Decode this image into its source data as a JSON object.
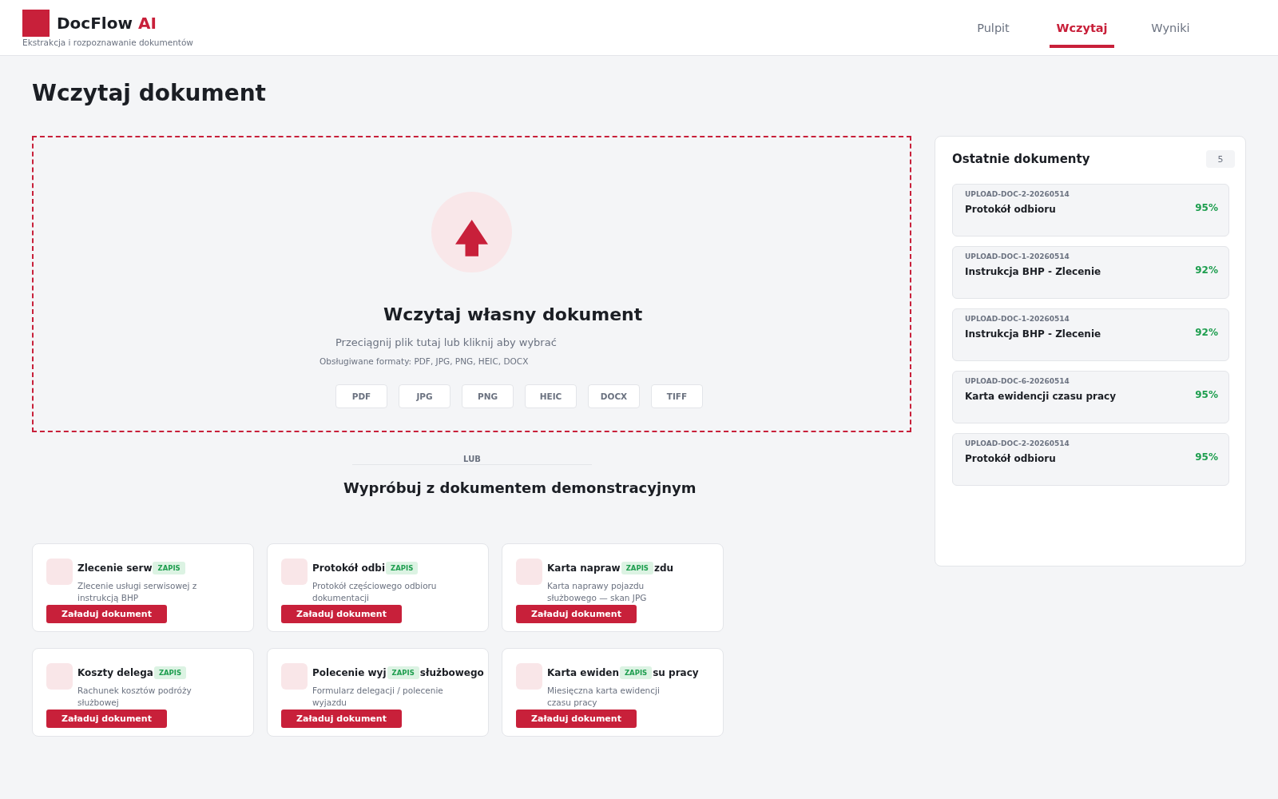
{
  "header": {
    "brand": "DocFlow",
    "brand_accent": "AI",
    "tagline": "Ekstrakcja i rozpoznawanie dokumentów",
    "nav": [
      {
        "label": "Pulpit",
        "selected": false
      },
      {
        "label": "Wczytaj",
        "selected": true
      },
      {
        "label": "Wyniki",
        "selected": false
      }
    ]
  },
  "page_title": "Wczytaj dokument",
  "dropzone": {
    "title": "Wczytaj własny dokument",
    "hint": "Przeciągnij plik tutaj lub kliknij aby wybrać",
    "formats_note": "Obsługiwane formaty: PDF, JPG, PNG, HEIC, DOCX",
    "format_chips": [
      "PDF",
      "JPG",
      "PNG",
      "HEIC",
      "DOCX",
      "TIFF"
    ]
  },
  "divider_label": "LUB",
  "demo": {
    "title": "Wypróbuj z dokumentem demonstracyjnym",
    "cards": [
      {
        "title": "Zlecenie serw",
        "tag": "ZAPIS",
        "description": "Zlecenie usługi serwisowej z instrukcją BHP",
        "button": "Załaduj dokument"
      },
      {
        "title": "Protokół odbi",
        "tag": "ZAPIS",
        "description": "Protokół częściowego odbioru dokumentacji",
        "button": "Załaduj dokument"
      },
      {
        "title": "Karta napraw",
        "tag": "ZAPIS",
        "title_tail": "zdu",
        "description": "Karta naprawy pojazdu służbowego — skan JPG",
        "button": "Załaduj dokument"
      },
      {
        "title": "Koszty delega",
        "tag": "ZAPIS",
        "description": "Rachunek kosztów podróży służbowej",
        "button": "Załaduj dokument"
      },
      {
        "title": "Polecenie wyj",
        "tag": "ZAPIS",
        "title_tail": "służbowego",
        "description": "Formularz delegacji / polecenie wyjazdu",
        "button": "Załaduj dokument"
      },
      {
        "title": "Karta ewiden",
        "tag": "ZAPIS",
        "title_tail": "su pracy",
        "description": "Miesięczna karta ewidencji czasu pracy",
        "button": "Załaduj dokument"
      }
    ]
  },
  "recent": {
    "title": "Ostatnie dokumenty",
    "count": "5",
    "items": [
      {
        "code": "UPLOAD-DOC-2-20260514",
        "name": "Protokół odbioru",
        "score": "95%"
      },
      {
        "code": "UPLOAD-DOC-1-20260514",
        "name": "Instrukcja BHP - Zlecenie",
        "score": "92%"
      },
      {
        "code": "UPLOAD-DOC-1-20260514",
        "name": "Instrukcja BHP - Zlecenie",
        "score": "92%"
      },
      {
        "code": "UPLOAD-DOC-6-20260514",
        "name": "Karta ewidencji czasu pracy",
        "score": "95%"
      },
      {
        "code": "UPLOAD-DOC-2-20260514",
        "name": "Protokół odbioru",
        "score": "95%"
      }
    ]
  }
}
